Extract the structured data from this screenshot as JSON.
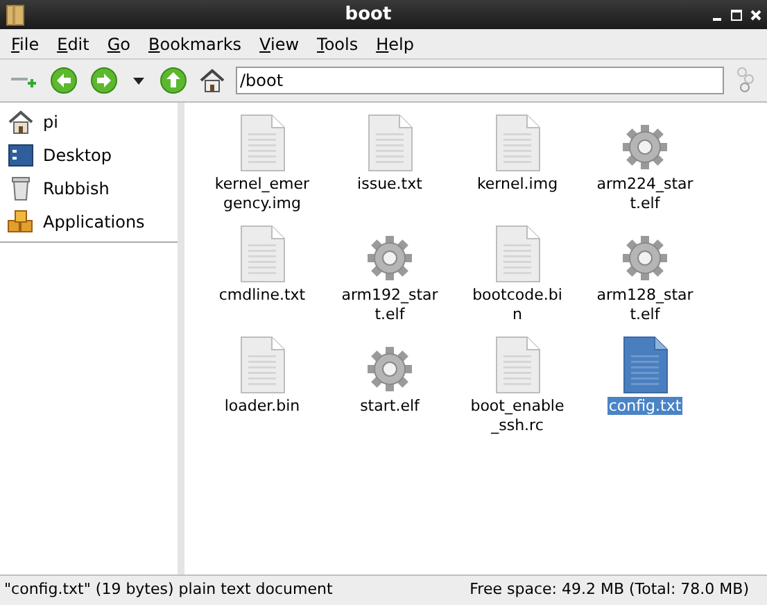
{
  "window": {
    "title": "boot"
  },
  "menu": [
    "File",
    "Edit",
    "Go",
    "Bookmarks",
    "View",
    "Tools",
    "Help"
  ],
  "location": {
    "value": "/boot"
  },
  "sidebar": {
    "items": [
      {
        "label": "pi",
        "kind": "home"
      },
      {
        "label": "Desktop",
        "kind": "desktop"
      },
      {
        "label": "Rubbish",
        "kind": "trash"
      },
      {
        "label": "Applications",
        "kind": "apps"
      }
    ]
  },
  "files": [
    {
      "name": "kernel_emergency.img",
      "kind": "doc",
      "selected": false
    },
    {
      "name": "issue.txt",
      "kind": "doc",
      "selected": false
    },
    {
      "name": "kernel.img",
      "kind": "doc",
      "selected": false
    },
    {
      "name": "arm224_start.elf",
      "kind": "gear",
      "selected": false
    },
    {
      "name": "cmdline.txt",
      "kind": "doc",
      "selected": false
    },
    {
      "name": "arm192_start.elf",
      "kind": "gear",
      "selected": false
    },
    {
      "name": "bootcode.bin",
      "kind": "doc",
      "selected": false
    },
    {
      "name": "arm128_start.elf",
      "kind": "gear",
      "selected": false
    },
    {
      "name": "loader.bin",
      "kind": "doc",
      "selected": false
    },
    {
      "name": "start.elf",
      "kind": "gear",
      "selected": false
    },
    {
      "name": "boot_enable_ssh.rc",
      "kind": "doc",
      "selected": false
    },
    {
      "name": "config.txt",
      "kind": "doc",
      "selected": true
    }
  ],
  "status_bar": {
    "info": "\"config.txt\" (19 bytes) plain text document",
    "free_space": "Free space: 49.2 MB (Total: 78.0 MB)"
  }
}
